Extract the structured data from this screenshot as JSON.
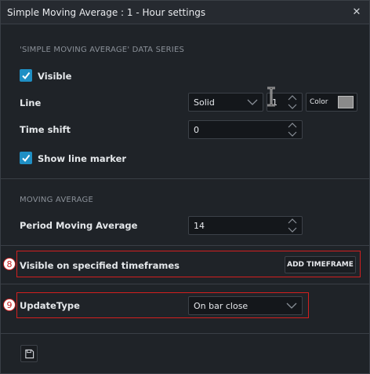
{
  "dialog": {
    "title": "Simple Moving Average : 1 - Hour settings",
    "close_icon": "close-icon"
  },
  "data_series": {
    "section_label": "'SIMPLE MOVING AVERAGE' DATA SERIES",
    "visible": {
      "label": "Visible",
      "checked": true
    },
    "line": {
      "label": "Line",
      "style_value": "Solid",
      "width_value": "1",
      "color_label": "Color",
      "color_value": "#8a8a8a"
    },
    "time_shift": {
      "label": "Time shift",
      "value": "0"
    },
    "show_line_marker": {
      "label": "Show line marker",
      "checked": true
    }
  },
  "moving_average": {
    "section_label": "MOVING AVERAGE",
    "period": {
      "label": "Period Moving Average",
      "value": "14"
    }
  },
  "timeframes": {
    "badge": "8",
    "label": "Visible on specified timeframes",
    "add_button": "ADD TIMEFRAME"
  },
  "update_type": {
    "badge": "9",
    "label": "UpdateType",
    "value": "On bar close"
  },
  "footer": {
    "save_icon": "save-icon"
  },
  "colors": {
    "accent": "#1f8fc4",
    "annotation": "#d21f1f"
  }
}
